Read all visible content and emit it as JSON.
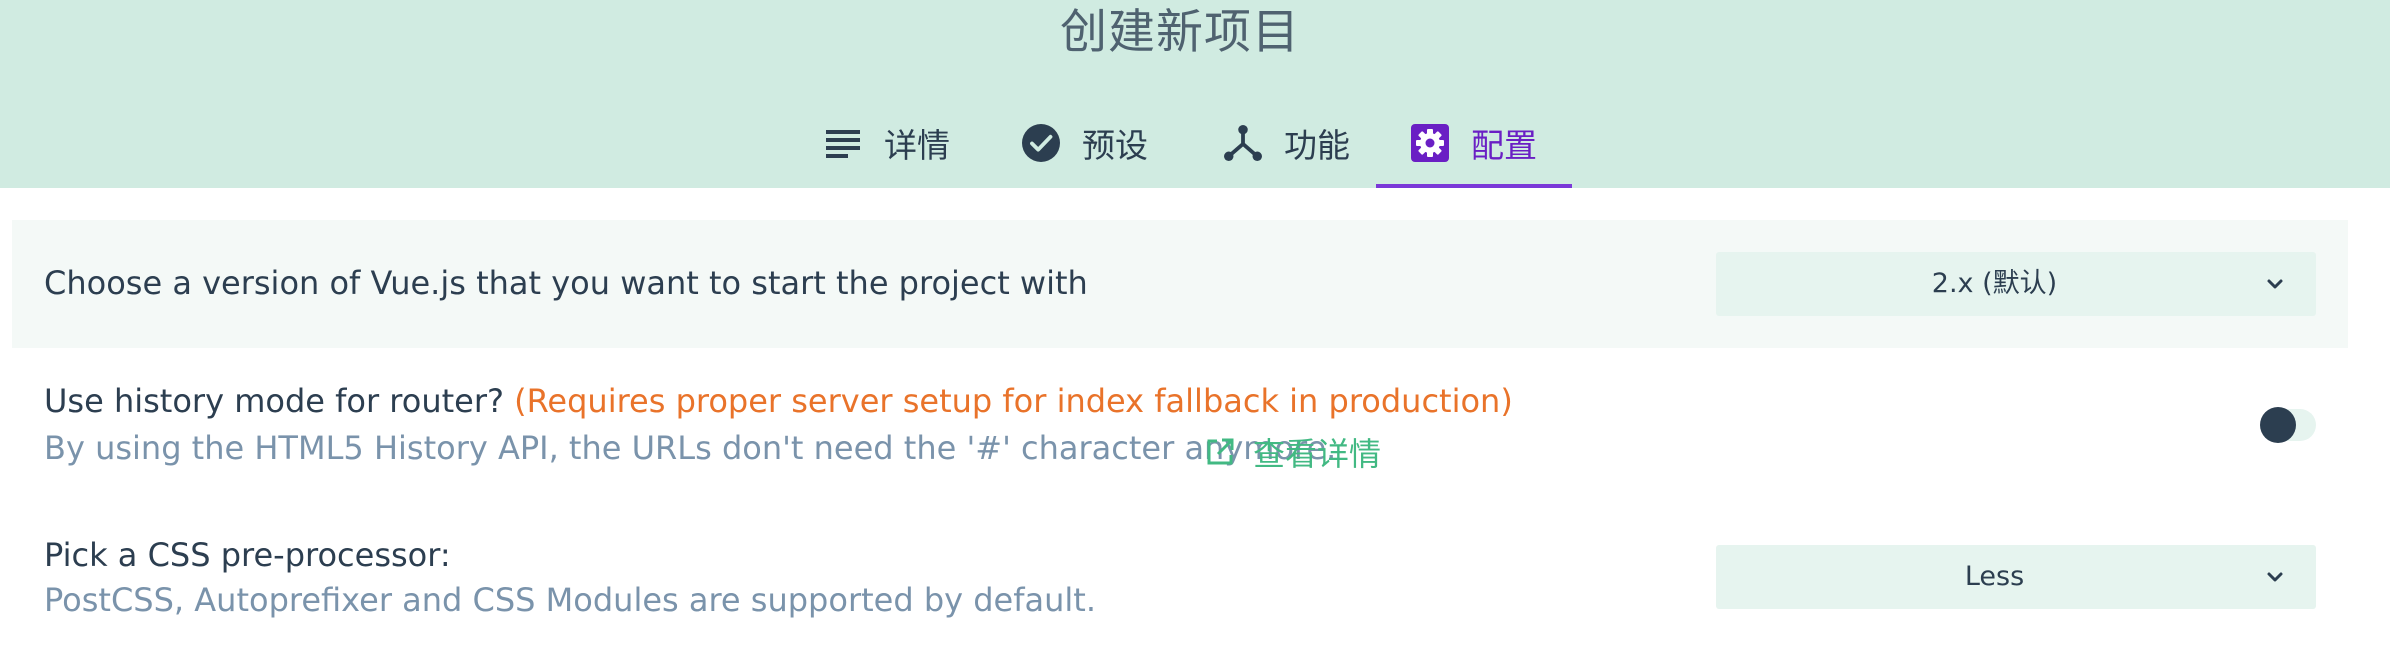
{
  "header": {
    "title": "创建新项目"
  },
  "tabs": [
    {
      "label": "详情",
      "icon": "list-icon"
    },
    {
      "label": "预设",
      "icon": "check-circle-icon"
    },
    {
      "label": "功能",
      "icon": "fork-icon"
    },
    {
      "label": "配置",
      "icon": "gear-icon",
      "active": true
    }
  ],
  "config": {
    "vue_version": {
      "label": "Choose a version of Vue.js that you want to start the project with",
      "selected": "2.x (默认)"
    },
    "history_mode": {
      "label": "Use history mode for router?",
      "warning": "(Requires proper server setup for index fallback in production)",
      "description": "By using the HTML5 History API, the URLs don't need the '#' character anymore.",
      "link_label": "查看详情",
      "enabled": false
    },
    "css_preprocessor": {
      "label": "Pick a CSS pre-processor:",
      "description": "PostCSS, Autoprefixer and CSS Modules are supported by default.",
      "selected": "Less"
    }
  },
  "colors": {
    "header_bg": "#d0ebe1",
    "accent": "#7b38d8",
    "warning": "#e9732a",
    "link": "#42b983",
    "text": "#2c3e50",
    "muted": "#7a93ab"
  }
}
